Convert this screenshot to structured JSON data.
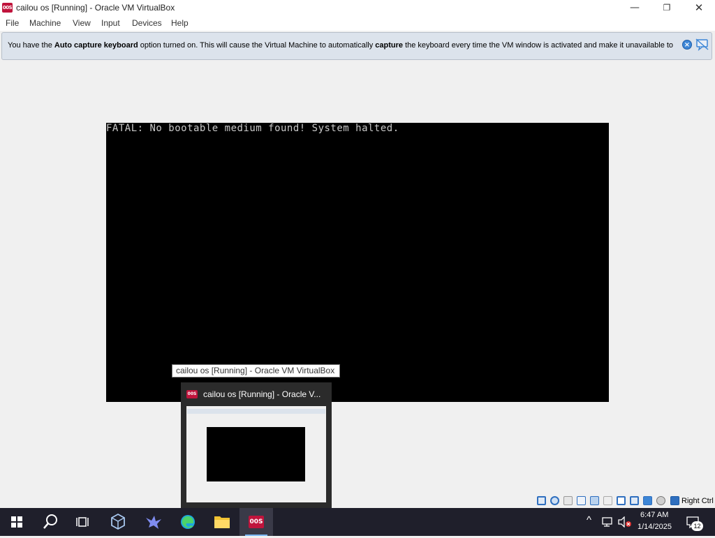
{
  "window": {
    "title": "cailou os  [Running] - Oracle VM VirtualBox",
    "app_icon_text": "00S",
    "controls": {
      "minimize": "—",
      "maximize": "❐",
      "close": "✕"
    }
  },
  "menu": [
    "File",
    "Machine",
    "View",
    "Input",
    "Devices",
    "Help"
  ],
  "banner": {
    "part1": "You have the ",
    "bold1": "Auto capture keyboard",
    "part2": " option turned on. This will cause the Virtual Machine to automatically ",
    "bold2": "capture",
    "part3": " the keyboard every time the VM window is activated and make it unavailable to",
    "close_icon": "×"
  },
  "vm": {
    "console_text": "FATAL: No bootable medium found! System halted."
  },
  "taskbar_tooltip": "cailou os  [Running] - Oracle VM VirtualBox",
  "preview": {
    "title": "cailou os  [Running] - Oracle V...",
    "icon_text": "00S"
  },
  "statusbar": {
    "host_key_label": "Right Ctrl",
    "icons": [
      "hard-disk-icon",
      "optical-drive-icon",
      "floppy-icon",
      "audio-icon",
      "network-icon",
      "usb-icon",
      "shared-folders-icon",
      "display-icon",
      "recording-icon",
      "cpu-icon",
      "mouse-integration-icon",
      "host-key-icon"
    ]
  },
  "taskbar": {
    "apps": [
      "start-icon",
      "search-icon",
      "task-view-icon",
      "virtualbox-icon",
      "bird-app-icon",
      "edge-icon",
      "file-explorer-icon",
      "vm-window-icon"
    ],
    "active_app_text": "00S"
  },
  "tray": {
    "time": "6:47 AM",
    "date": "1/14/2025",
    "notification_count": "12",
    "chevron": "^"
  },
  "colors": {
    "banner_bg": "#dce3ec",
    "vm_bg": "#000000",
    "taskbar_bg": "#1f1f2b",
    "app_icon": "#c0143c"
  }
}
